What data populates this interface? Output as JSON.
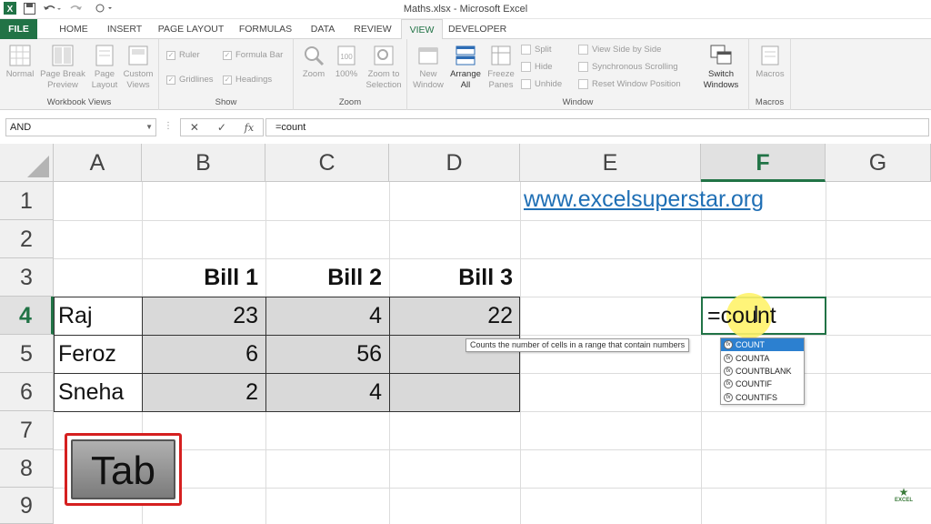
{
  "window": {
    "title": "Maths.xlsx - Microsoft Excel"
  },
  "ribbon_tabs": [
    "FILE",
    "HOME",
    "INSERT",
    "PAGE LAYOUT",
    "FORMULAS",
    "DATA",
    "REVIEW",
    "VIEW",
    "DEVELOPER"
  ],
  "active_tab": "VIEW",
  "ribbon": {
    "workbook_views": {
      "label": "Workbook Views",
      "normal": "Normal",
      "page_break_preview": "Page Break Preview",
      "page_layout": "Page Layout",
      "custom_views": "Custom Views"
    },
    "show": {
      "label": "Show",
      "ruler": "Ruler",
      "formula_bar": "Formula Bar",
      "gridlines": "Gridlines",
      "headings": "Headings"
    },
    "zoom": {
      "label": "Zoom",
      "zoom": "Zoom",
      "hundred": "100%",
      "zoom_to_selection": "Zoom to Selection"
    },
    "window_group": {
      "label": "Window",
      "new_window": "New Window",
      "arrange_all": "Arrange All",
      "freeze_panes": "Freeze Panes",
      "split": "Split",
      "hide": "Hide",
      "unhide": "Unhide",
      "view_side_by_side": "View Side by Side",
      "synchronous_scrolling": "Synchronous Scrolling",
      "reset_window_position": "Reset Window Position",
      "switch_windows": "Switch Windows"
    },
    "macros": {
      "label": "Macros",
      "macros": "Macros"
    }
  },
  "formula_bar": {
    "name_box": "AND",
    "formula": "=count",
    "fx": "fx"
  },
  "columns": [
    "A",
    "B",
    "C",
    "D",
    "E",
    "F",
    "G"
  ],
  "rows": [
    "1",
    "2",
    "3",
    "4",
    "5",
    "6",
    "7",
    "8",
    "9"
  ],
  "cells": {
    "E1": "www.excelsuperstar.org",
    "B3": "Bill 1",
    "C3": "Bill 2",
    "D3": "Bill 3",
    "A4": "Raj",
    "B4": "23",
    "C4": "4",
    "D4": "22",
    "A5": "Feroz",
    "B5": "6",
    "C5": "56",
    "A6": "Sneha",
    "B6": "2",
    "C6": "4",
    "F4_edit": "=count"
  },
  "tooltip": "Counts the number of cells in a range that contain numbers",
  "autocomplete": [
    "COUNT",
    "COUNTA",
    "COUNTBLANK",
    "COUNTIF",
    "COUNTIFS"
  ],
  "overlay_key": "Tab",
  "logo_text": "EXCEL"
}
